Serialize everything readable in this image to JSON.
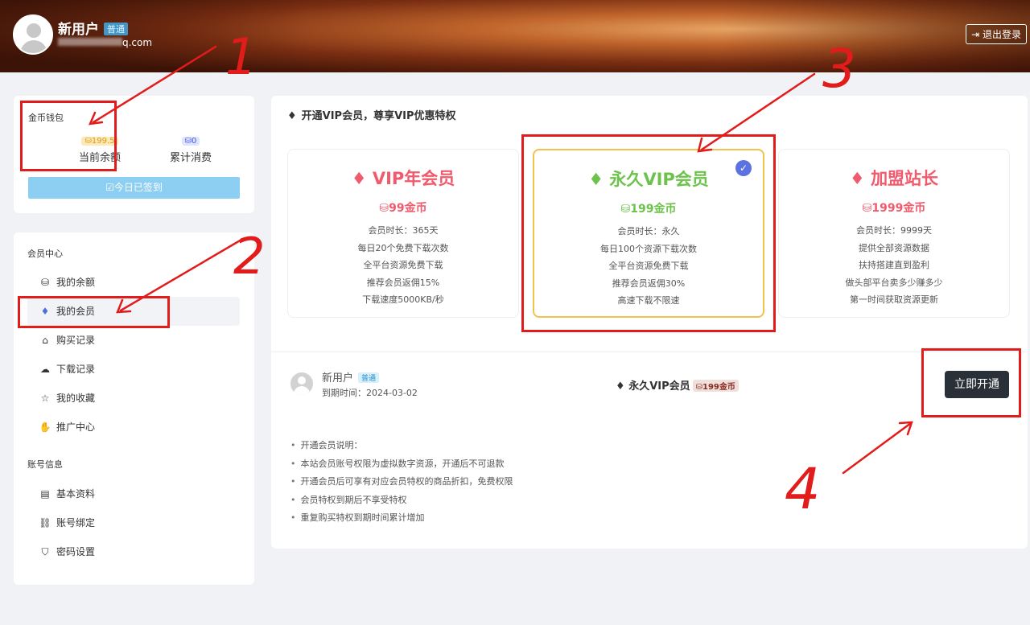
{
  "header": {
    "user_name": "新用户",
    "user_level": "普通",
    "email_visible": "q.com",
    "logout_icon": "logout-icon",
    "logout_label": "退出登录"
  },
  "wallet": {
    "title": "金币钱包",
    "balance_value": "199.5",
    "balance_label": "当前余额",
    "spend_value": "0",
    "spend_label": "累计消费",
    "signed_label": "今日已签到"
  },
  "menu": {
    "group1": "会员中心",
    "items1": [
      {
        "label": "我的余额",
        "icon": "coins-icon"
      },
      {
        "label": "我的会员",
        "icon": "diamond-icon"
      },
      {
        "label": "购买记录",
        "icon": "basket-icon"
      },
      {
        "label": "下载记录",
        "icon": "cloud-download-icon"
      },
      {
        "label": "我的收藏",
        "icon": "star-icon"
      },
      {
        "label": "推广中心",
        "icon": "hand-coin-icon"
      }
    ],
    "group2": "账号信息",
    "items2": [
      {
        "label": "基本资料",
        "icon": "id-card-icon"
      },
      {
        "label": "账号绑定",
        "icon": "link-icon"
      },
      {
        "label": "密码设置",
        "icon": "shield-icon"
      }
    ]
  },
  "main": {
    "heading": "开通VIP会员，尊享VIP优惠特权",
    "plans": [
      {
        "title": "VIP年会员",
        "price": "99金币",
        "features": [
          "会员时长：365天",
          "每日20个免费下载次数",
          "全平台资源免费下载",
          "推荐会员返佣15%",
          "下载速度5000KB/秒"
        ]
      },
      {
        "title": "永久VIP会员",
        "price": "199金币",
        "features": [
          "会员时长：永久",
          "每日100个资源下载次数",
          "全平台资源免费下载",
          "推荐会员返佣30%",
          "高速下载不限速"
        ]
      },
      {
        "title": "加盟站长",
        "price": "1999金币",
        "features": [
          "会员时长：9999天",
          "提供全部资源数据",
          "扶持搭建直到盈利",
          "做头部平台卖多少赚多少",
          "第一时间获取资源更新"
        ]
      }
    ],
    "summary": {
      "user_name": "新用户",
      "user_level": "普通",
      "expiry": "到期时间：2024-03-02",
      "plan_name": "永久VIP会员",
      "plan_price": "199金币",
      "buy_label": "立即开通"
    },
    "notes": [
      "开通会员说明：",
      "本站会员账号权限为虚拟数字资源，开通后不可退款",
      "开通会员后可享有对应会员特权的商品折扣，免费权限",
      "会员特权到期后不享受特权",
      "重复购买特权到期时间累计增加"
    ]
  },
  "annotations": [
    "1",
    "2",
    "3",
    "4"
  ],
  "colors": {
    "accent_red": "#f05a6c",
    "accent_green": "#6cc24a",
    "annotation": "#e21b1b"
  }
}
